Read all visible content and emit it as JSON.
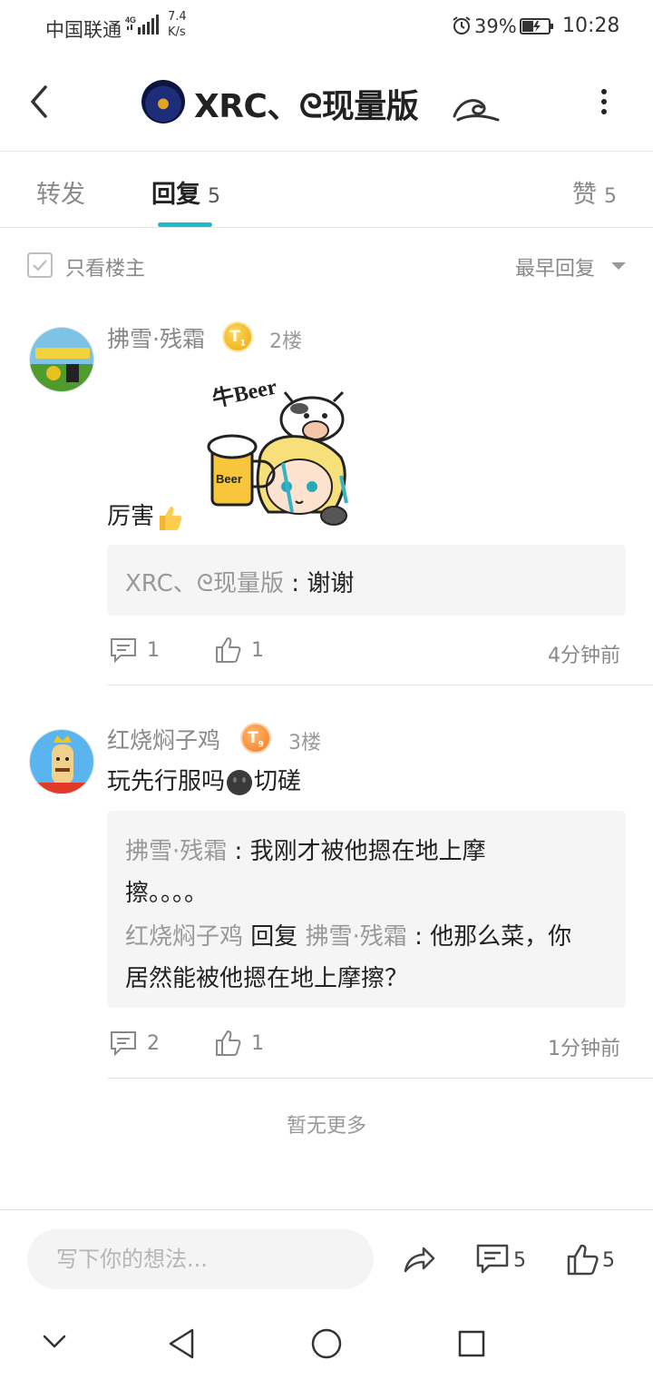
{
  "status_bar": {
    "carrier": "中国联通",
    "network": "4G",
    "speed_value": "7.4",
    "speed_unit": "K/s",
    "battery": "39%",
    "time": "10:28"
  },
  "header": {
    "title": "XRC、ᘓ现量版",
    "back_icon": "back-arrow-icon",
    "more_icon": "more-vertical-icon"
  },
  "tabs": [
    {
      "label": "转发",
      "count": ""
    },
    {
      "label": "回复",
      "count": "5",
      "active": true
    },
    {
      "label": "赞",
      "count": "5"
    }
  ],
  "filter": {
    "only_op": "只看楼主",
    "sort": "最早回复"
  },
  "comments": [
    {
      "user": "拂雪·残霜",
      "level": "T",
      "level_sub": "1",
      "floor": "2楼",
      "text": "厉害",
      "sticker": "牛Beer",
      "sticker_mug": "Beer",
      "quotes": [
        {
          "name": "XRC、ᘓ现量版",
          "sep": " : ",
          "text": "谢谢"
        }
      ],
      "reply_count": "1",
      "like_count": "1",
      "time": "4分钟前"
    },
    {
      "user": "红烧焖子鸡",
      "level": "T",
      "level_sub": "9",
      "floor": "3楼",
      "text_a": "玩先行服吗",
      "text_b": "切磋",
      "quotes": [
        {
          "name": "拂雪·残霜",
          "sep": " : ",
          "text": "我刚才被他摁在地上摩",
          "text_cont": "擦。。。。"
        },
        {
          "name": "红烧焖子鸡",
          "mid": " 回复 ",
          "name2": "拂雪·残霜",
          "sep": " : ",
          "text": "他那么菜，你",
          "text_cont": "居然能被他摁在地上摩擦？"
        }
      ],
      "reply_count": "2",
      "like_count": "1",
      "time": "1分钟前"
    }
  ],
  "no_more": "暂无更多",
  "bottom_bar": {
    "placeholder": "写下你的想法...",
    "reply_count": "5",
    "like_count": "5"
  },
  "colors": {
    "accent": "#1ebbc9",
    "gold_badge": "#e8a90f",
    "orange_badge": "#f07b20"
  }
}
